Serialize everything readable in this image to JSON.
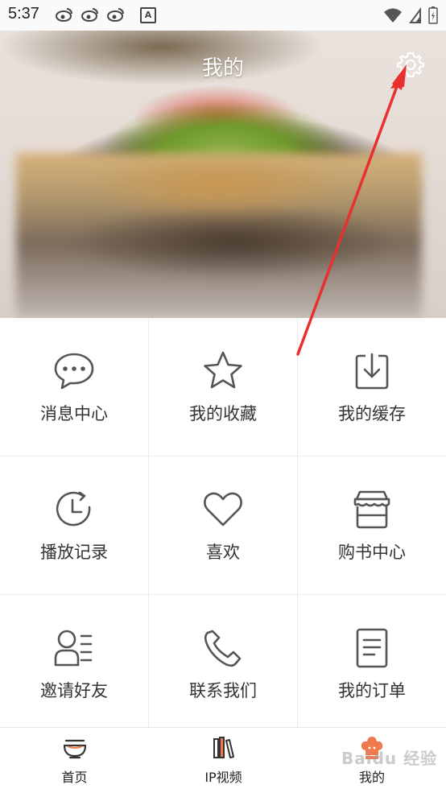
{
  "status_bar": {
    "time": "5:37",
    "icons": [
      "weibo-icon",
      "weibo-icon",
      "weibo-icon",
      "a-badge-icon",
      "wifi-icon",
      "signal-icon",
      "battery-icon"
    ],
    "badge_letter": "A"
  },
  "header": {
    "title": "我的",
    "settings_icon": "gear-icon"
  },
  "grid": {
    "items": [
      {
        "label": "消息中心",
        "icon": "chat-bubble-icon"
      },
      {
        "label": "我的收藏",
        "icon": "star-icon"
      },
      {
        "label": "我的缓存",
        "icon": "download-icon"
      },
      {
        "label": "播放记录",
        "icon": "history-clock-icon"
      },
      {
        "label": "喜欢",
        "icon": "heart-icon"
      },
      {
        "label": "购书中心",
        "icon": "store-icon"
      },
      {
        "label": "邀请好友",
        "icon": "invite-user-icon"
      },
      {
        "label": "联系我们",
        "icon": "phone-icon"
      },
      {
        "label": "我的订单",
        "icon": "order-document-icon"
      }
    ]
  },
  "bottom_nav": {
    "items": [
      {
        "label": "首页",
        "icon": "bowl-icon",
        "active": false
      },
      {
        "label": "IP视频",
        "icon": "books-icon",
        "active": false
      },
      {
        "label": "我的",
        "icon": "chef-icon",
        "active": true
      }
    ]
  },
  "colors": {
    "icon_stroke": "#555555",
    "active_accent": "#f07a4e",
    "annotation_red": "#e8302f"
  },
  "watermark": "Baidu 经验"
}
